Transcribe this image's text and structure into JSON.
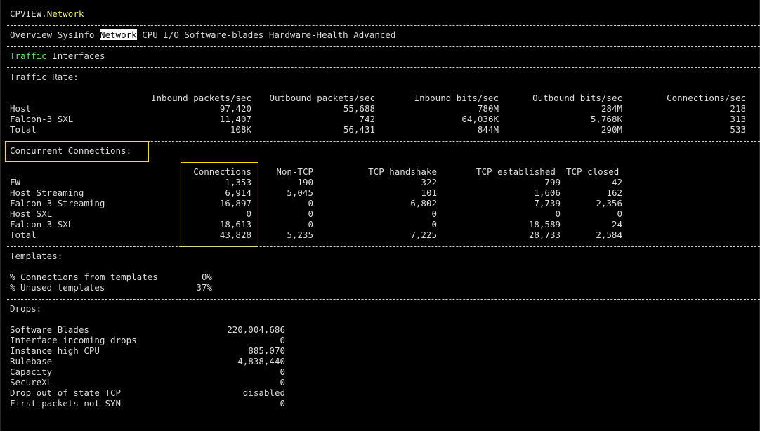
{
  "title": {
    "app": "CPVIEW",
    "dot": ".",
    "view": "Network"
  },
  "menu": {
    "items": [
      "Overview",
      "SysInfo",
      "Network",
      "CPU",
      "I/O",
      "Software-blades",
      "Hardware-Health",
      "Advanced"
    ],
    "selected": "Network"
  },
  "subtabs": {
    "items": [
      "Traffic",
      "Interfaces"
    ],
    "active": "Traffic"
  },
  "traffic": {
    "heading": "Traffic Rate:",
    "columns": [
      "Inbound packets/sec",
      "Outbound packets/sec",
      "Inbound bits/sec",
      "Outbound bits/sec",
      "Connections/sec"
    ],
    "rows": [
      {
        "label": "Host",
        "values": [
          "97,420",
          "55,688",
          "780M",
          "284M",
          "218"
        ]
      },
      {
        "label": "Falcon-3 SXL",
        "values": [
          "11,407",
          "742",
          "64,036K",
          "5,768K",
          "313"
        ]
      },
      {
        "label": "Total",
        "values": [
          "108K",
          "56,431",
          "844M",
          "290M",
          "533"
        ]
      }
    ]
  },
  "concurrent": {
    "heading": "Concurrent Connections:",
    "columns": [
      "Connections",
      "Non-TCP",
      "TCP handshake",
      "TCP established",
      "TCP closed"
    ],
    "rows": [
      {
        "label": "FW",
        "values": [
          "1,353",
          "190",
          "322",
          "799",
          "42"
        ]
      },
      {
        "label": "Host Streaming",
        "values": [
          "6,914",
          "5,045",
          "101",
          "1,606",
          "162"
        ]
      },
      {
        "label": "Falcon-3 Streaming",
        "values": [
          "16,897",
          "0",
          "6,802",
          "7,739",
          "2,356"
        ]
      },
      {
        "label": "Host SXL",
        "values": [
          "0",
          "0",
          "0",
          "0",
          "0"
        ]
      },
      {
        "label": "Falcon-3 SXL",
        "values": [
          "18,613",
          "0",
          "0",
          "18,589",
          "24"
        ]
      },
      {
        "label": "Total",
        "values": [
          "43,828",
          "5,235",
          "7,225",
          "28,733",
          "2,584"
        ]
      }
    ]
  },
  "templates": {
    "heading": "Templates:",
    "rows": [
      {
        "label": "% Connections from templates",
        "value": "0%"
      },
      {
        "label": "% Unused templates",
        "value": "37%"
      }
    ]
  },
  "drops": {
    "heading": "Drops:",
    "rows": [
      {
        "label": "Software Blades",
        "value": "220,004,686"
      },
      {
        "label": "Interface incoming drops",
        "value": "0"
      },
      {
        "label": "Instance high CPU",
        "value": "885,070"
      },
      {
        "label": "Rulebase",
        "value": "4,838,440"
      },
      {
        "label": "Capacity",
        "value": "0"
      },
      {
        "label": "SecureXL",
        "value": "0"
      },
      {
        "label": "Drop out of state TCP",
        "value": "disabled"
      },
      {
        "label": "First packets not SYN",
        "value": "0"
      }
    ]
  },
  "colors": {
    "background": "#000000",
    "text": "#dcdcdc",
    "title_accent": "#f0f06a",
    "active_tab": "#6fe36f",
    "highlight_box": "#f2e600"
  }
}
